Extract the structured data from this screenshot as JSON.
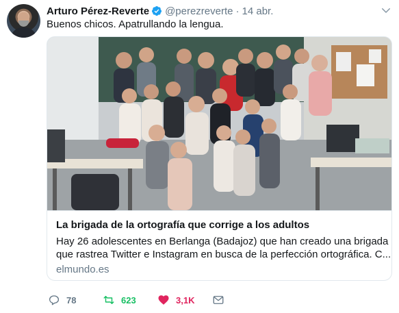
{
  "tweet": {
    "author_name": "Arturo Pérez-Reverte",
    "handle": "@perezreverte",
    "separator": "·",
    "date": "14 abr.",
    "text": "Buenos chicos. Apatrullando la lengua."
  },
  "card": {
    "title": "La brigada de la ortografía que corrige a los adultos",
    "description_line1": "Hay 26 adolescentes en Berlanga (Badajoz) que han creado una brigada",
    "description_line2": "que rastrea Twitter e Instagram en busca de la perfección ortográfica. C...",
    "domain": "elmundo.es"
  },
  "actions": {
    "reply_count": "78",
    "retweet_count": "623",
    "like_count": "3,1K"
  },
  "colors": {
    "verified": "#1da1f2",
    "retweet": "#17bf63",
    "like": "#e0245e",
    "secondary_text": "#657786"
  },
  "icons": [
    "verified-badge-icon",
    "chevron-down-icon",
    "reply-icon",
    "retweet-icon",
    "heart-icon",
    "envelope-icon"
  ]
}
